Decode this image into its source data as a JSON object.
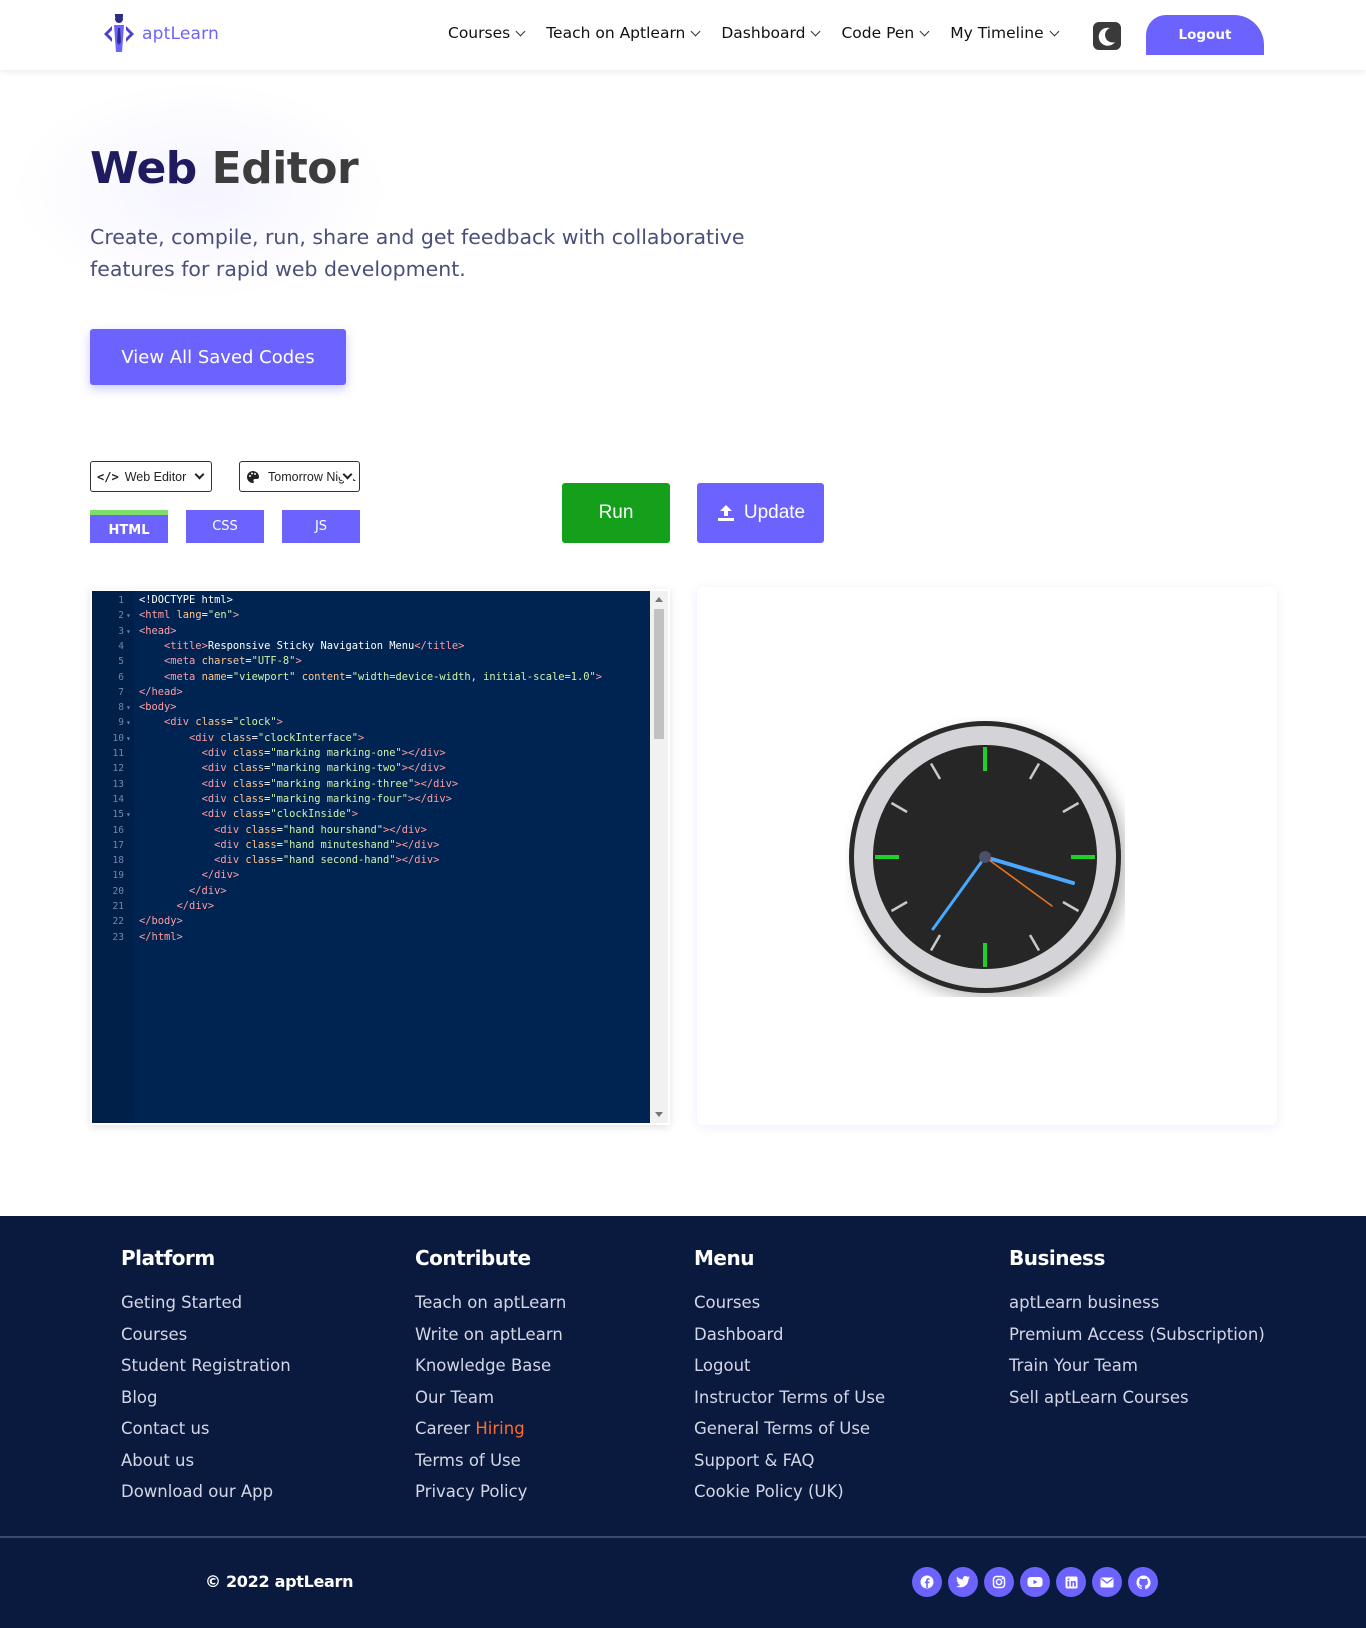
{
  "nav": {
    "logo_text": "aptLearn",
    "items": [
      "Courses",
      "Teach on Aptlearn",
      "Dashboard",
      "Code Pen",
      "My Timeline"
    ],
    "logout_label": "Logout"
  },
  "hero": {
    "title_word1": "Web",
    "title_word2": "Editor",
    "subtitle": "Create, compile, run, share and get feedback with collaborative features for rapid web development.",
    "saved_codes_label": "View All Saved Codes"
  },
  "editor": {
    "mode_select": "Web Editor",
    "theme_select": "Tomorrow Night Blue",
    "tabs": [
      "HTML",
      "CSS",
      "JS"
    ],
    "active_tab": "HTML",
    "run_label": "Run",
    "update_label": "Update",
    "code_lines": [
      "<!DOCTYPE html>",
      "<html lang=\"en\">",
      "<head>",
      "    <title>Responsive Sticky Navigation Menu</title>",
      "    <meta charset=\"UTF-8\">",
      "    <meta name=\"viewport\" content=\"width=device-width, initial-scale=1.0\">",
      "</head>",
      "<body>",
      "    <div class=\"clock\">",
      "        <div class=\"clockInterface\">",
      "          <div class=\"marking marking-one\"></div>",
      "          <div class=\"marking marking-two\"></div>",
      "          <div class=\"marking marking-three\"></div>",
      "          <div class=\"marking marking-four\"></div>",
      "          <div class=\"clockInside\">",
      "            <div class=\"hand hourshand\"></div>",
      "            <div class=\"hand minuteshand\"></div>",
      "            <div class=\"hand second-hand\"></div>",
      "          </div>",
      "        </div>",
      "      </div>",
      "</body>",
      "</html>"
    ],
    "fold_lines": [
      2,
      3,
      8,
      9,
      10,
      15
    ]
  },
  "colors": {
    "accent": "#6c63ff",
    "run_green": "#14a01a",
    "footer_bg": "#0a1a3f",
    "hiring": "#ff6b2c",
    "editor_bg": "#002451"
  },
  "footer": {
    "columns": [
      {
        "heading": "Platform",
        "links": [
          "Geting Started",
          "Courses",
          "Student Registration",
          "Blog",
          "Contact us",
          "About us",
          "Download our App"
        ]
      },
      {
        "heading": "Contribute",
        "links": [
          "Teach on aptLearn",
          "Write on aptLearn",
          "Knowledge Base",
          "Our Team",
          "Career",
          "Terms of Use",
          "Privacy Policy"
        ]
      },
      {
        "heading": "Menu",
        "links": [
          "Courses",
          "Dashboard",
          "Logout",
          "Instructor Terms of Use",
          "General Terms of Use",
          "Support & FAQ",
          "Cookie Policy (UK)"
        ]
      },
      {
        "heading": "Business",
        "links": [
          "aptLearn business",
          "Premium Access (Subscription)",
          "Train Your Team",
          "Sell aptLearn Courses"
        ]
      }
    ],
    "hiring_badge": "Hiring",
    "copyright": "© 2022 aptLearn",
    "social_icons": [
      "facebook-icon",
      "twitter-icon",
      "instagram-icon",
      "youtube-icon",
      "linkedin-icon",
      "email-icon",
      "github-icon"
    ]
  }
}
